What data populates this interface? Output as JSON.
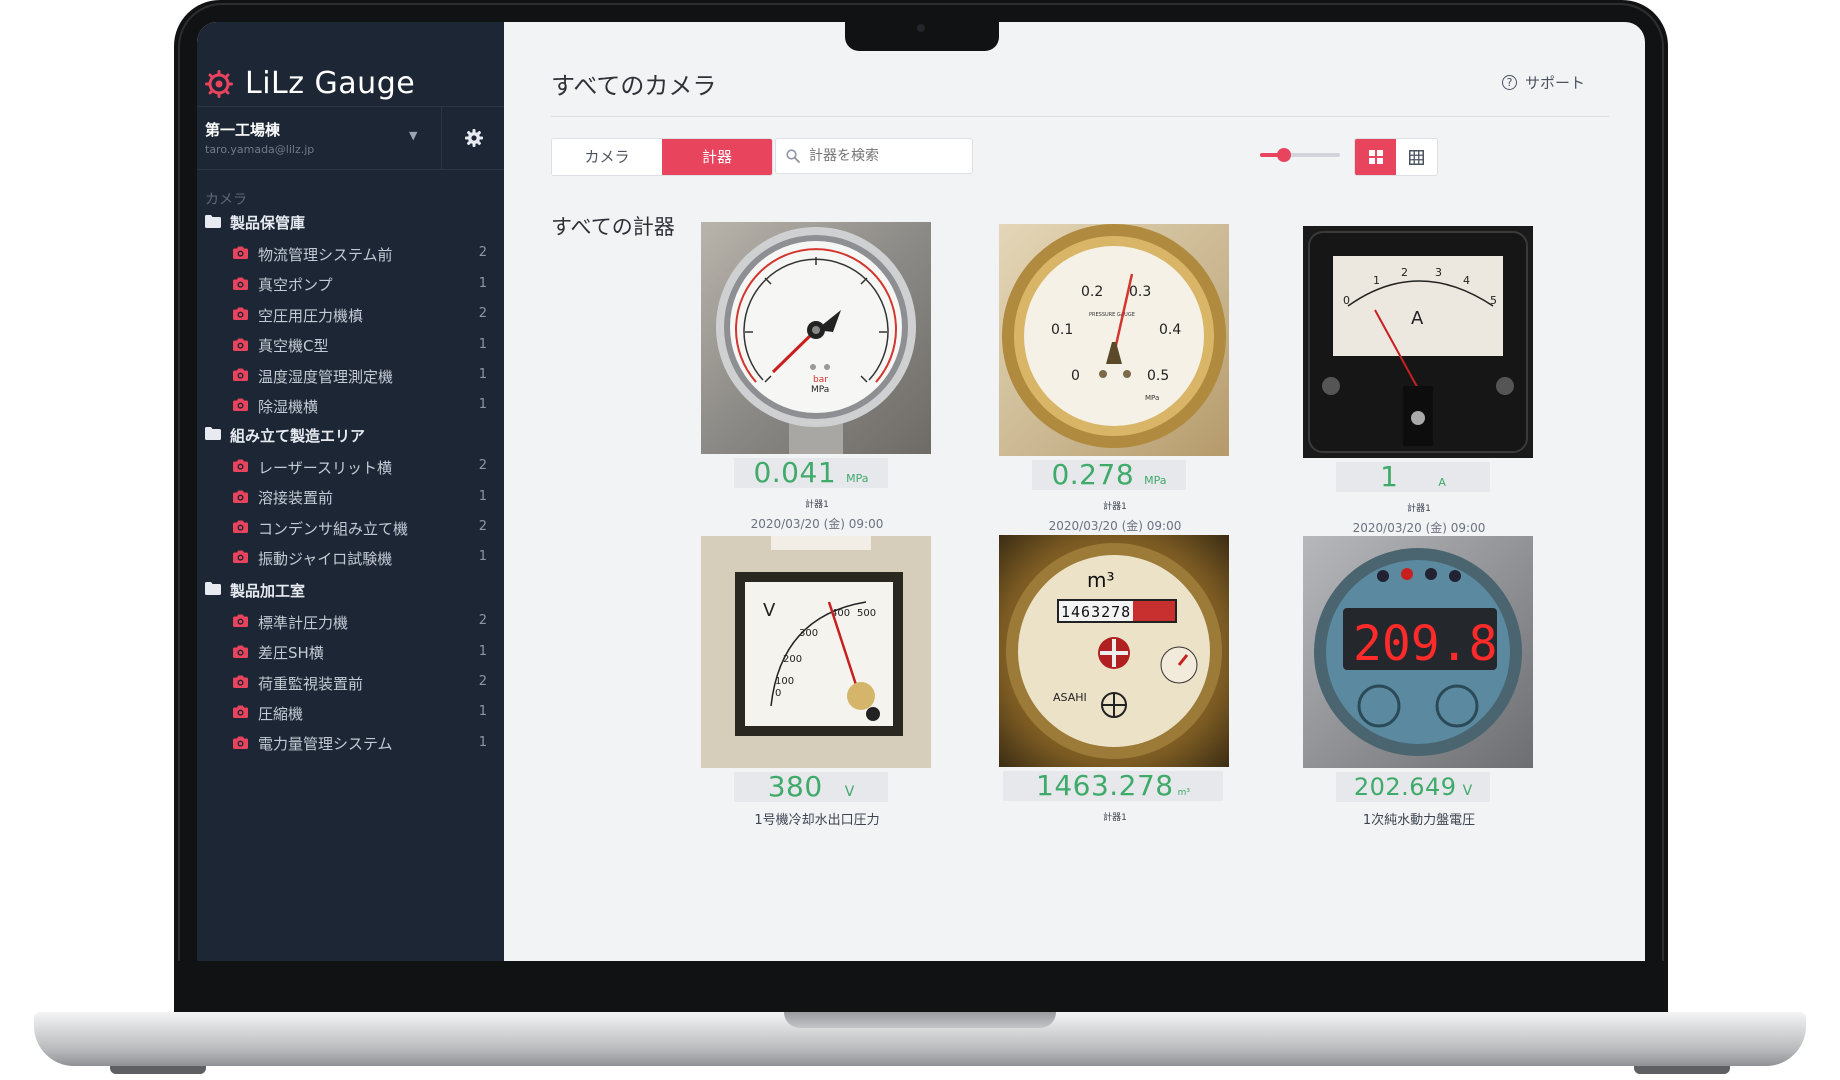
{
  "brand": {
    "name": "LiLz Gauge",
    "accent": "#e8445d"
  },
  "site": {
    "name": "第一工場棟",
    "email": "taro.yamada@lilz.jp"
  },
  "sidebar": {
    "section_label": "カメラ",
    "folders": [
      {
        "name": "製品保管庫",
        "cameras": [
          {
            "name": "物流管理システム前",
            "count": "2"
          },
          {
            "name": "真空ポンプ",
            "count": "1"
          },
          {
            "name": "空圧用圧力機槙",
            "count": "2"
          },
          {
            "name": "真空機C型",
            "count": "1"
          },
          {
            "name": "温度湿度管理測定機",
            "count": "1"
          },
          {
            "name": "除湿機横",
            "count": "1"
          }
        ]
      },
      {
        "name": "組み立て製造エリア",
        "cameras": [
          {
            "name": "レーザースリット横",
            "count": "2"
          },
          {
            "name": "溶接装置前",
            "count": "1"
          },
          {
            "name": "コンデンサ組み立て機",
            "count": "2"
          },
          {
            "name": "振動ジャイロ試験機",
            "count": "1"
          }
        ]
      },
      {
        "name": "製品加工室",
        "cameras": [
          {
            "name": "標準計圧力機",
            "count": "2"
          },
          {
            "name": "差圧SH横",
            "count": "1"
          },
          {
            "name": "荷重監視装置前",
            "count": "2"
          },
          {
            "name": "圧縮機",
            "count": "1"
          },
          {
            "name": "電力量管理システム",
            "count": "1"
          }
        ]
      }
    ]
  },
  "header": {
    "title": "すべてのカメラ",
    "support": "サポート"
  },
  "toolbar": {
    "tab_camera": "カメラ",
    "tab_meter": "計器",
    "search_placeholder": "計器を検索",
    "zoom_level": 0.3
  },
  "content": {
    "section_title": "すべての計器",
    "meters": [
      {
        "value": "0.041",
        "unit": "MPa",
        "label": "計器1",
        "timestamp": "2020/03/20 (金) 09:00"
      },
      {
        "value": "0.278",
        "unit": "MPa",
        "label": "計器1",
        "timestamp": "2020/03/20 (金) 09:00"
      },
      {
        "value": "1",
        "unit": "A",
        "label": "計器1",
        "timestamp": "2020/03/20 (金) 09:00"
      },
      {
        "value": "380",
        "unit": "V",
        "label": "1号機冷却水出口圧力",
        "timestamp": ""
      },
      {
        "value": "1463.278",
        "unit": "m³",
        "label": "計器1",
        "timestamp": ""
      },
      {
        "value": "202.649",
        "unit": "V",
        "label": "1次純水動力盤電圧",
        "timestamp": ""
      }
    ],
    "photo_text": {
      "gauge1_unit": "bar",
      "gauge1_unit2": "MPa",
      "gauge2_brand": "PRESSURE GAUGE",
      "gauge2_unit": "MPa",
      "ammeter_symbol": "A",
      "voltmeter_symbol": "V",
      "water_unit": "m³",
      "water_counter": "1463278",
      "water_brand": "ASAHI",
      "digital": "209.8"
    }
  }
}
